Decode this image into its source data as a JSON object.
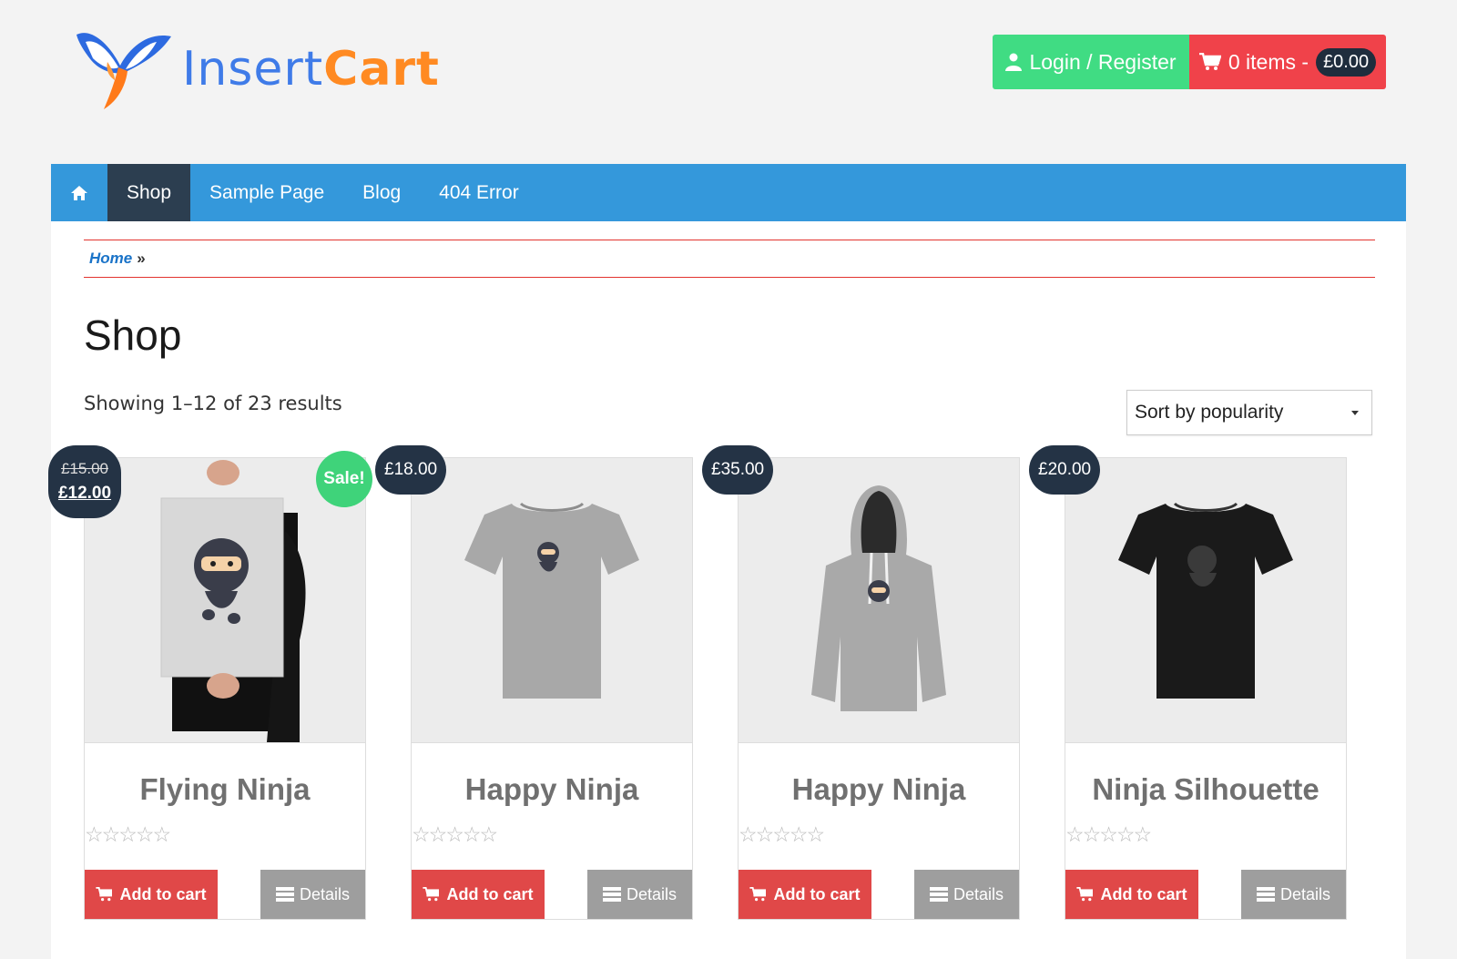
{
  "header": {
    "logo_text_part1": "Insert",
    "logo_text_part2": "Cart",
    "login_label": "Login / Register",
    "cart_label": "0 items -",
    "cart_total": "£0.00"
  },
  "nav": {
    "items": [
      {
        "label": "Shop",
        "active": true
      },
      {
        "label": "Sample Page"
      },
      {
        "label": "Blog"
      },
      {
        "label": "404 Error"
      }
    ]
  },
  "breadcrumb": {
    "home": "Home",
    "separator": "»"
  },
  "page": {
    "title": "Shop",
    "result_count": "Showing 1–12 of 23 results",
    "sort_selected": "Sort by popularity"
  },
  "products": [
    {
      "name": "Flying Ninja",
      "old_price": "£15.00",
      "price": "£12.00",
      "sale_label": "Sale!",
      "stars": "☆☆☆☆☆",
      "add_label": "Add to cart",
      "details_label": "Details"
    },
    {
      "name": "Happy Ninja",
      "price": "£18.00",
      "stars": "☆☆☆☆☆",
      "add_label": "Add to cart",
      "details_label": "Details"
    },
    {
      "name": "Happy Ninja",
      "price": "£35.00",
      "stars": "☆☆☆☆☆",
      "add_label": "Add to cart",
      "details_label": "Details"
    },
    {
      "name": "Ninja Silhouette",
      "price": "£20.00",
      "stars": "☆☆☆☆☆",
      "add_label": "Add to cart",
      "details_label": "Details"
    }
  ],
  "colors": {
    "nav_bg": "#3498db",
    "nav_active": "#2c3e50",
    "login_bg": "#40dc83",
    "cart_bg": "#f0424a",
    "add_to_cart": "#e04848",
    "sale": "#3fd37a"
  }
}
